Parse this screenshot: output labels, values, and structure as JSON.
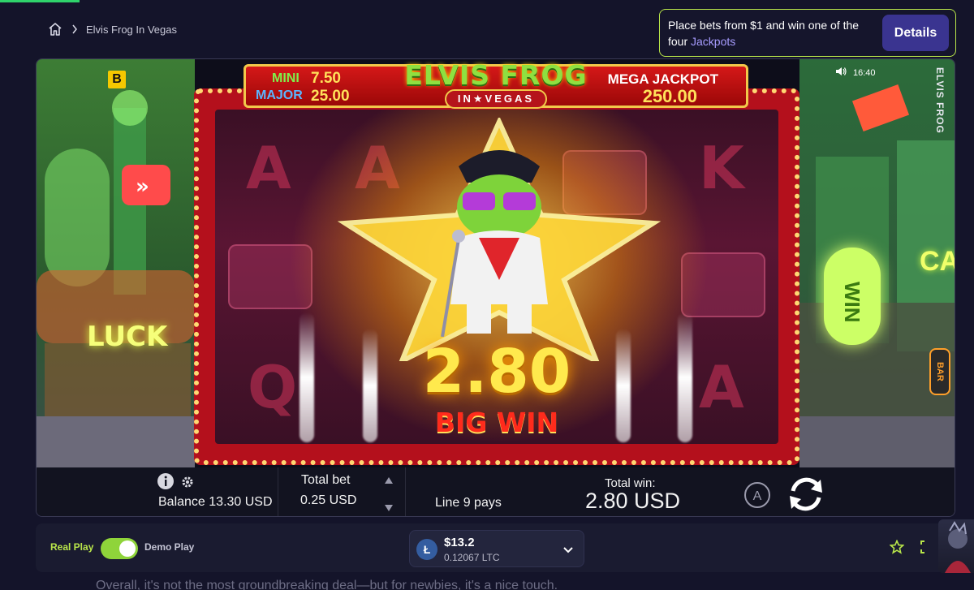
{
  "breadcrumb": {
    "home_icon": "home-icon",
    "separator_icon": "chevron-right-icon",
    "current": "Elvis Frog In Vegas"
  },
  "promo": {
    "text_before": "Place bets from $1 and win one of the four ",
    "highlight": "Jackpots",
    "button_label": "Details"
  },
  "game": {
    "brand_badge": "B",
    "clock": "16:40",
    "sound_icon": "speaker-icon",
    "side_title": "ELVIS FROG",
    "logo_title": "ELVIS FROG",
    "logo_subtitle": "IN★VEGAS",
    "jackpots": {
      "mini_label": "MINI",
      "mini_value": "7.50",
      "major_label": "MAJOR",
      "major_value": "25.00",
      "mega_label": "MEGA JACKPOT",
      "mega_value": "250.00"
    },
    "reel_symbols": [
      "A",
      "A",
      "K",
      "Q",
      "A"
    ],
    "win_amount": "2.80",
    "win_banner": "BIG WIN",
    "signs": {
      "luck": "LUCK",
      "win": "WIN",
      "bar": "BAR",
      "ca": "CA"
    }
  },
  "controls": {
    "balance": "Balance 13.30 USD",
    "total_bet_label": "Total bet",
    "total_bet_value": "0.25 USD",
    "line_pays": "Line 9 pays",
    "total_win_label": "Total win:",
    "total_win_value": "2.80 USD",
    "auto_label": "A"
  },
  "bottom_bar": {
    "real_play": "Real Play",
    "demo_play": "Demo Play",
    "toggle_on": true,
    "currency_usd": "$13.2",
    "currency_ltc": "0.12067 LTC",
    "coin_symbol": "Ł"
  },
  "footer_text": "Overall, it's not the most groundbreaking deal—but for newbies, it's a nice touch.",
  "colors": {
    "accent_green": "#b9e64a",
    "details_button": "#3a3490",
    "page_bg": "#14142a"
  }
}
